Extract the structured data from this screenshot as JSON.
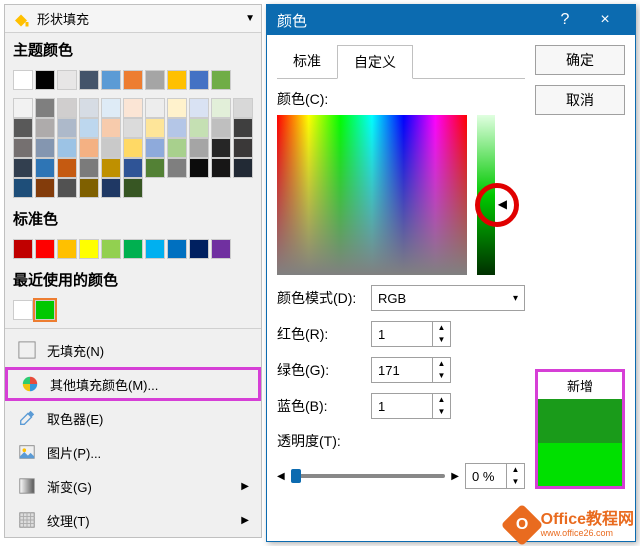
{
  "left": {
    "header": "形状填充",
    "theme_label": "主题颜色",
    "theme_colors_row1": [
      "#ffffff",
      "#000000",
      "#e7e6e6",
      "#44546a",
      "#5b9bd5",
      "#ed7d31",
      "#a5a5a5",
      "#ffc000",
      "#4472c4",
      "#70ad47"
    ],
    "theme_tints": [
      [
        "#f2f2f2",
        "#7f7f7f",
        "#d0cece",
        "#d6dce4",
        "#deebf6",
        "#fbe5d5",
        "#ededed",
        "#fff2cc",
        "#d9e2f3",
        "#e2efd9"
      ],
      [
        "#d8d8d8",
        "#595959",
        "#aeabab",
        "#adb9ca",
        "#bdd7ee",
        "#f7cbac",
        "#dbdbdb",
        "#fee599",
        "#b4c6e7",
        "#c5e0b3"
      ],
      [
        "#bfbfbf",
        "#3f3f3f",
        "#757070",
        "#8496b0",
        "#9cc3e5",
        "#f4b183",
        "#c9c9c9",
        "#ffd965",
        "#8eaadb",
        "#a8d08d"
      ],
      [
        "#a5a5a5",
        "#262626",
        "#3a3838",
        "#323f4f",
        "#2e75b5",
        "#c55a11",
        "#7b7b7b",
        "#bf9000",
        "#2f5496",
        "#538135"
      ],
      [
        "#7f7f7f",
        "#0c0c0c",
        "#171616",
        "#222a35",
        "#1e4e79",
        "#833c0b",
        "#525252",
        "#7f6000",
        "#1f3864",
        "#375623"
      ]
    ],
    "standard_label": "标准色",
    "standard_colors": [
      "#c00000",
      "#ff0000",
      "#ffc000",
      "#ffff00",
      "#92d050",
      "#00b050",
      "#00b0f0",
      "#0070c0",
      "#002060",
      "#7030a0"
    ],
    "recent_label": "最近使用的颜色",
    "recent_colors": [
      "#ffffff",
      "#00c800"
    ],
    "no_fill": "无填充(N)",
    "more_colors": "其他填充颜色(M)...",
    "eyedropper": "取色器(E)",
    "picture": "图片(P)...",
    "gradient": "渐变(G)",
    "texture": "纹理(T)"
  },
  "dialog": {
    "title": "颜色",
    "help": "?",
    "close": "×",
    "ok": "确定",
    "cancel": "取消",
    "tab_std": "标准",
    "tab_custom": "自定义",
    "color_c": "颜色(C):",
    "mode_label": "颜色模式(D):",
    "mode_value": "RGB",
    "red_label": "红色(R):",
    "red_value": "1",
    "green_label": "绿色(G):",
    "green_value": "171",
    "blue_label": "蓝色(B):",
    "blue_value": "1",
    "transp_label": "透明度(T):",
    "transp_value": "0 %",
    "new_label": "新增",
    "new_color": "#1a9b1a",
    "cur_color": "#00e000"
  },
  "watermark": {
    "brand": "Office教程网",
    "url": "www.office26.com"
  }
}
